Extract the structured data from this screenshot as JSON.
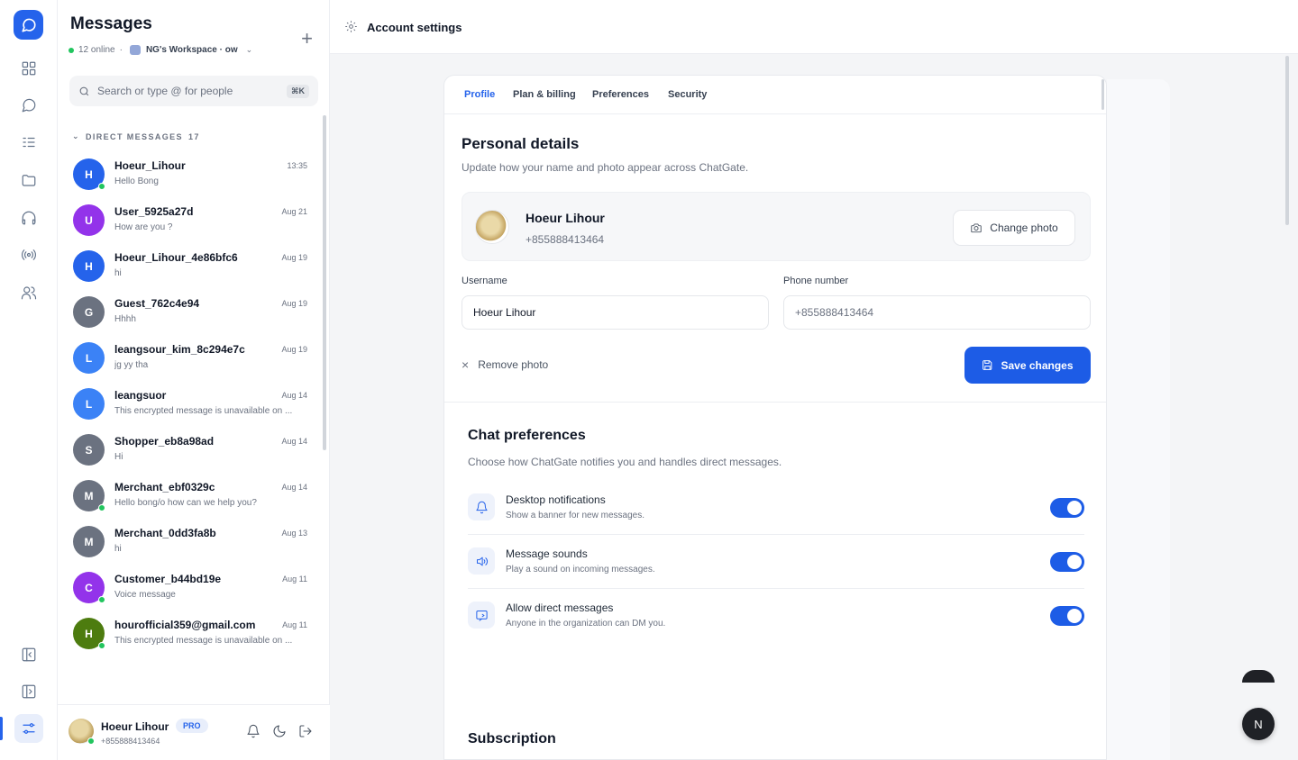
{
  "messages": {
    "title": "Messages",
    "plus_label": "+",
    "online": "12 online",
    "separator": "·",
    "workspace": "NG's Workspace · ow",
    "search_placeholder": "Search or type @ for people",
    "search_kbd": "⌘K",
    "dm_heading": "DIRECT MESSAGES",
    "dm_count": "17",
    "items": [
      {
        "initial": "H",
        "name": "Hoeur_Lihour",
        "preview": "Hello Bong",
        "time": "13:35",
        "color": "#2563eb",
        "online": true
      },
      {
        "initial": "U",
        "name": "User_5925a27d",
        "preview": "How are you ?",
        "time": "Aug 21",
        "color": "#9333ea",
        "online": false
      },
      {
        "initial": "H",
        "name": "Hoeur_Lihour_4e86bfc6",
        "preview": "hi",
        "time": "Aug 19",
        "color": "#2563eb",
        "online": false
      },
      {
        "initial": "G",
        "name": "Guest_762c4e94",
        "preview": "Hhhh",
        "time": "Aug 19",
        "color": "#6b7280",
        "online": false
      },
      {
        "initial": "L",
        "name": "leangsour_kim_8c294e7c",
        "preview": "jg yy tha",
        "time": "Aug 19",
        "color": "#3b82f6",
        "online": false
      },
      {
        "initial": "L",
        "name": "leangsuor",
        "preview": "This encrypted message is unavailable on ...",
        "time": "Aug 14",
        "color": "#3b82f6",
        "online": false
      },
      {
        "initial": "S",
        "name": "Shopper_eb8a98ad",
        "preview": "Hi",
        "time": "Aug 14",
        "color": "#6b7280",
        "online": false
      },
      {
        "initial": "M",
        "name": "Merchant_ebf0329c",
        "preview": "Hello bong/o how can we help you?",
        "time": "Aug 14",
        "color": "#6b7280",
        "online": true
      },
      {
        "initial": "M",
        "name": "Merchant_0dd3fa8b",
        "preview": "hi",
        "time": "Aug 13",
        "color": "#6b7280",
        "online": false
      },
      {
        "initial": "C",
        "name": "Customer_b44bd19e",
        "preview": "Voice message",
        "time": "Aug 11",
        "color": "#9333ea",
        "online": true
      },
      {
        "initial": "H",
        "name": "hourofficial359@gmail.com",
        "preview": "This encrypted message is unavailable on ...",
        "time": "Aug 11",
        "color": "#4d7c0f",
        "online": true
      }
    ]
  },
  "me": {
    "name": "Hoeur Lihour",
    "badge": "PRO",
    "phone": "+855888413464"
  },
  "topbar": {
    "title": "Account settings"
  },
  "tabs": [
    "Profile",
    "Plan & billing",
    "Preferences",
    "Security"
  ],
  "personal": {
    "title": "Personal details",
    "desc": "Update how your name and photo appear across ChatGate.",
    "name": "Hoeur Lihour",
    "phone": "+855888413464",
    "change_photo": "Change photo",
    "username_label": "Username",
    "username_value": "Hoeur Lihour",
    "phone_label": "Phone number",
    "phone_value": "+855888413464",
    "remove_photo": "Remove photo",
    "save": "Save changes"
  },
  "chat_prefs": {
    "title": "Chat preferences",
    "desc": "Choose how ChatGate notifies you and handles direct messages.",
    "rows": [
      {
        "title": "Desktop notifications",
        "desc": "Show a banner for new messages.",
        "on": true
      },
      {
        "title": "Message sounds",
        "desc": "Play a sound on incoming messages.",
        "on": true
      },
      {
        "title": "Allow direct messages",
        "desc": "Anyone in the organization can DM you.",
        "on": true
      }
    ]
  },
  "subscription": {
    "title": "Subscription"
  },
  "fab_label": "N",
  "colors": {
    "accent": "#2563eb",
    "button": "#1d5ce6",
    "online": "#22c55e"
  }
}
